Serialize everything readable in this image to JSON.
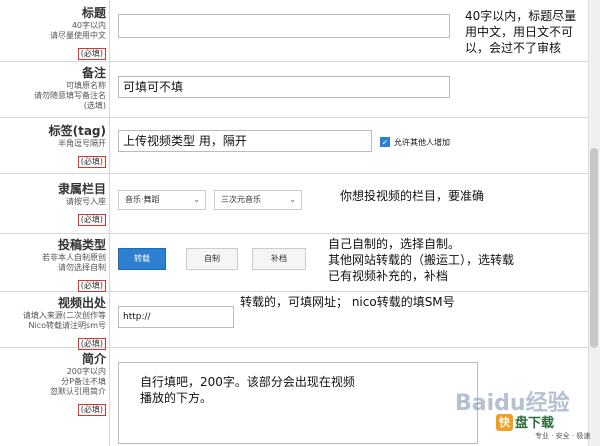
{
  "rows": {
    "title": {
      "label": "标题",
      "desc": [
        "40字以内",
        "请尽量使用中文"
      ],
      "required": "(必填)",
      "note": [
        "40字以内，标题尽量",
        "用中文，用日文不可",
        "以，会过不了审核"
      ]
    },
    "remark": {
      "label": "备注",
      "desc": [
        "可填原名称",
        "请勿随意填写备注名",
        "(选填)"
      ],
      "value": "可填可不填"
    },
    "tags": {
      "label": "标签(tag)",
      "desc": [
        "半角逗号隔开"
      ],
      "required": "(必填)",
      "value": "上传视频类型 用，隔开",
      "checkbox_label": "允许其他人增加"
    },
    "category": {
      "label": "隶属栏目",
      "desc": [
        "请按号入座"
      ],
      "required": "(必填)",
      "select1": "音乐·舞蹈",
      "select2": "三次元音乐",
      "note": "你想投视频的栏目，要准确"
    },
    "type": {
      "label": "投稿类型",
      "desc": [
        "若非本人自制原创",
        "请勿选择自制"
      ],
      "required": "(必填)",
      "buttons": [
        "转载",
        "自制",
        "补档"
      ],
      "note": [
        "自己自制的，选择自制。",
        "其他网站转载的（搬运工），选转载",
        "已有视频补充的，补档"
      ]
    },
    "source": {
      "label": "视频出处",
      "desc": [
        "请填入来源(二次创作等",
        "Nico转载请注明sm号"
      ],
      "required": "(必填)",
      "value": "http://",
      "note": "转载的，可填网址； nico转载的填SM号"
    },
    "intro": {
      "label": "简介",
      "desc": [
        "200字以内",
        "分P备注不填",
        "忽默认引用简介"
      ],
      "required": "(必填)",
      "note": [
        "自行填吧，200字。该部分会出现在视频",
        "播放的下方。"
      ]
    }
  },
  "watermark": "Baidu经验",
  "brand": {
    "logo": "快",
    "name": "盘下载",
    "sub": "专业 · 安全 · 极速"
  }
}
